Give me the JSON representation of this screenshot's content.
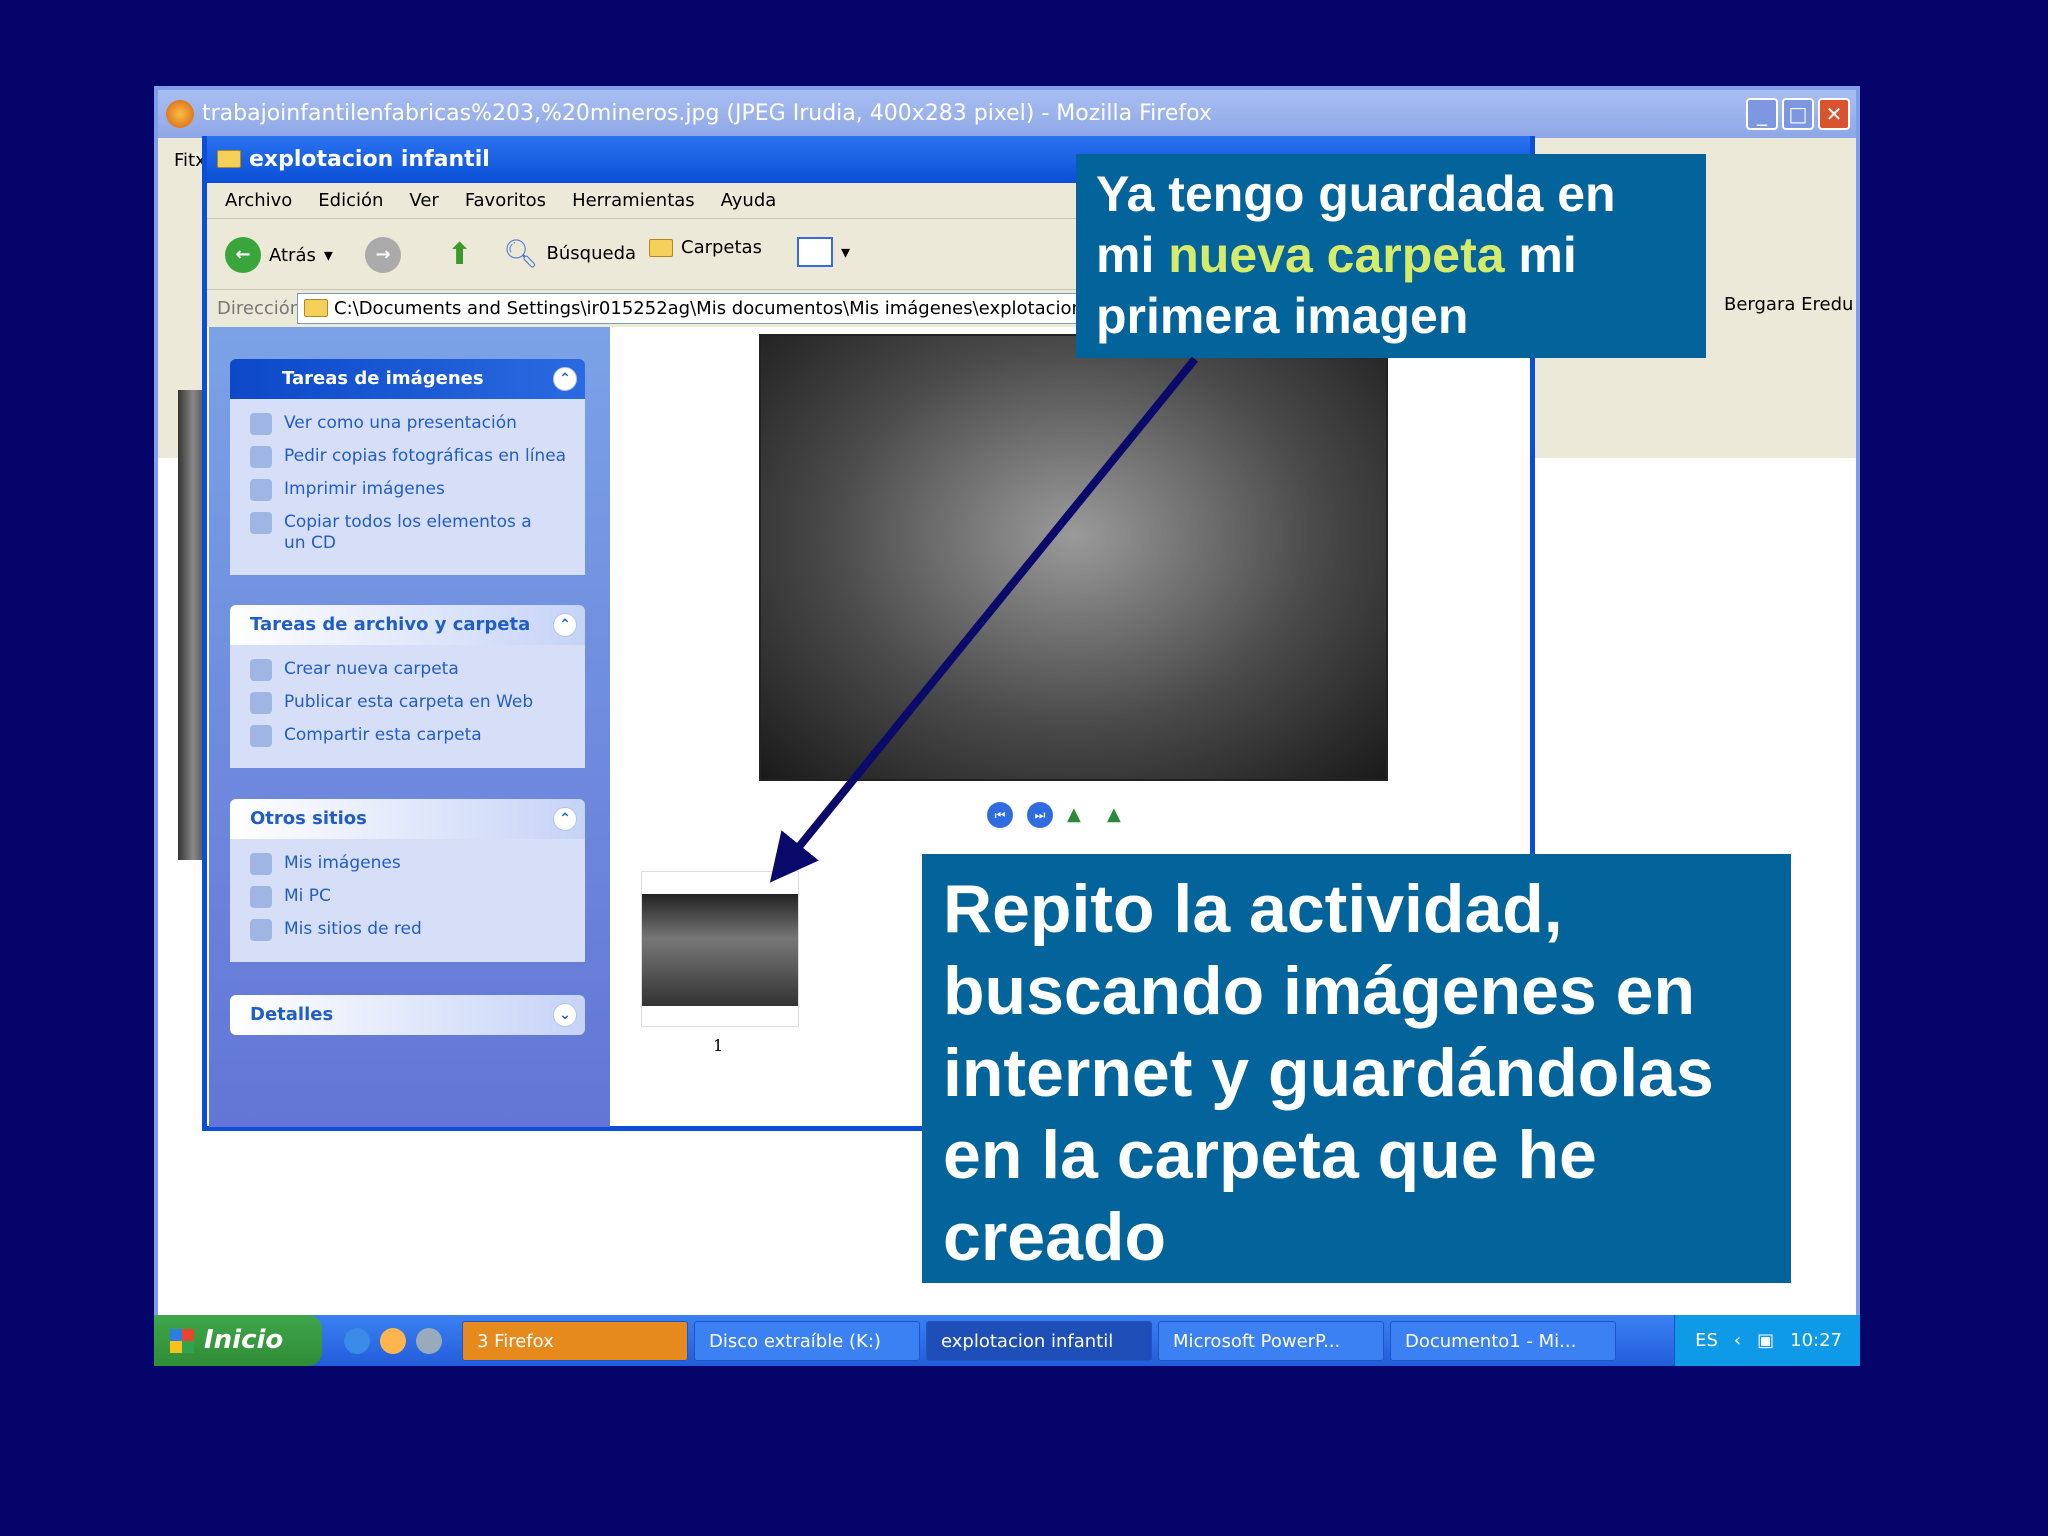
{
  "firefox": {
    "title": "trabajoinfantilenfabricas%203,%20mineros.jpg (JPEG Irudia, 400x283 pixel) - Mozilla Firefox",
    "menu_first": "Fitx",
    "bookmarks": "Bergara   Eredu"
  },
  "explorer": {
    "title": "explotacion infantil",
    "menu": [
      "Archivo",
      "Edición",
      "Ver",
      "Favoritos",
      "Herramientas",
      "Ayuda"
    ],
    "toolbar": {
      "back": "Atrás",
      "search": "Búsqueda",
      "folders": "Carpetas"
    },
    "address_label": "Dirección",
    "address": "C:\\Documents and Settings\\ir015252ag\\Mis documentos\\Mis imágenes\\explotacion infantil",
    "panels": [
      {
        "title": "Tareas de imágenes",
        "items": [
          "Ver como una presentación",
          "Pedir copias fotográficas en línea",
          "Imprimir imágenes",
          "Copiar todos los elementos a un CD"
        ]
      },
      {
        "title": "Tareas de archivo y carpeta",
        "items": [
          "Crear nueva carpeta",
          "Publicar esta carpeta en Web",
          "Compartir esta carpeta"
        ]
      },
      {
        "title": "Otros sitios",
        "items": [
          "Mis imágenes",
          "Mi PC",
          "Mis sitios de red"
        ]
      },
      {
        "title": "Detalles",
        "items": []
      }
    ],
    "thumbnail_label": "1"
  },
  "callouts": {
    "top_a": "Ya tengo guardada en mi ",
    "top_highlight": "nueva carpeta",
    "top_b": " mi primera imagen",
    "bottom": "Repito la actividad, buscando imágenes en internet y guardándolas en la carpeta que he creado",
    "highlight_color": "#d6eb6a",
    "box_color": "#03639b"
  },
  "taskbar": {
    "start": "Inicio",
    "buttons": [
      "3 Firefox",
      "Disco extraíble (K:)",
      "explotacion infantil",
      "Microsoft PowerP...",
      "Documento1 - Mi..."
    ],
    "lang": "ES",
    "time": "10:27"
  }
}
